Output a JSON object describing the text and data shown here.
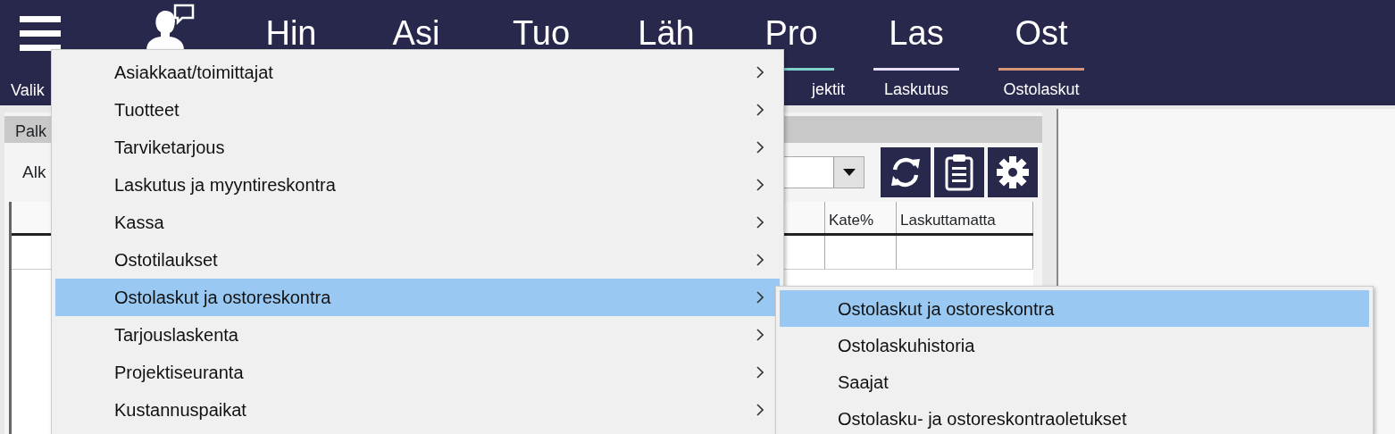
{
  "header": {
    "menu_label": "Valik",
    "modules": [
      {
        "abbr": "Hin"
      },
      {
        "abbr": "Asi"
      },
      {
        "abbr": "Tuo"
      },
      {
        "abbr": "Läh"
      },
      {
        "abbr": "Pro",
        "label": "jektit",
        "color": "#7fd1cc",
        "cut_off": true
      },
      {
        "abbr": "Las",
        "label": "Laskutus",
        "color": "#e8def8",
        "cut_off": false
      },
      {
        "abbr": "Ost",
        "label": "Ostolaskut",
        "color": "#d9957a",
        "cut_off": false
      }
    ]
  },
  "panel": {
    "tab": "Palk",
    "filter_label": "Alk",
    "table": {
      "columns": [
        "Kate%",
        "Laskuttamatta"
      ]
    }
  },
  "menu": {
    "items": [
      {
        "label": "Asiakkaat/toimittajat",
        "selected": false
      },
      {
        "label": "Tuotteet",
        "selected": false
      },
      {
        "label": "Tarviketarjous",
        "selected": false
      },
      {
        "label": "Laskutus ja myyntireskontra",
        "selected": false
      },
      {
        "label": "Kassa",
        "selected": false
      },
      {
        "label": "Ostotilaukset",
        "selected": false
      },
      {
        "label": "Ostolaskut ja ostoreskontra",
        "selected": true
      },
      {
        "label": "Tarjouslaskenta",
        "selected": false
      },
      {
        "label": "Projektiseuranta",
        "selected": false
      },
      {
        "label": "Kustannuspaikat",
        "selected": false
      }
    ]
  },
  "submenu": {
    "items": [
      {
        "label": "Ostolaskut ja ostoreskontra",
        "selected": true
      },
      {
        "label": "Ostolaskuhistoria",
        "selected": false
      },
      {
        "label": "Saajat",
        "selected": false
      },
      {
        "label": "Ostolasku- ja ostoreskontraoletukset",
        "selected": false
      }
    ]
  }
}
